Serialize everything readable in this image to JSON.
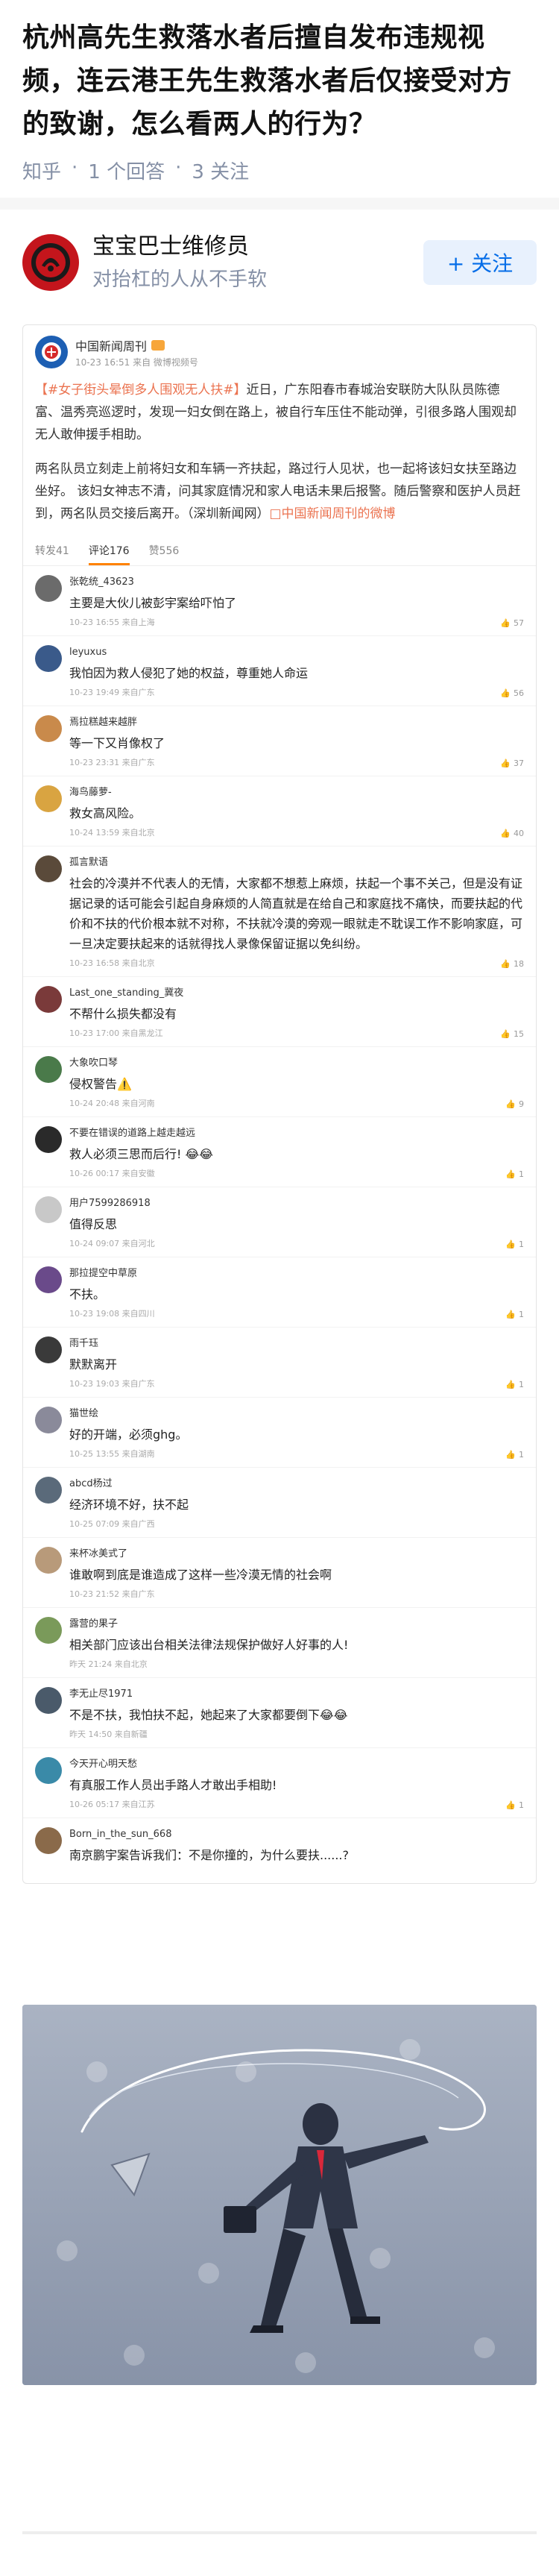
{
  "question": {
    "title": "杭州高先生救落水者后擅自发布违规视频，连云港王先生救落水者后仅接受对方的致谢，怎么看两人的行为？",
    "source": "知乎",
    "answers": "1 个回答",
    "followers": "3 关注"
  },
  "author": {
    "name": "宝宝巴士维修员",
    "bio": "对抬杠的人从不手软",
    "follow_label": "+ 关注"
  },
  "weibo": {
    "account": "中国新闻周刊",
    "time": "10-23 16:51 来自 微博视频号",
    "hashtag": "【#女子街头晕倒多人围观无人扶#】",
    "paragraph1": "近日，广东阳春市春城治安联防大队队员陈德富、温秀亮巡逻时，发现一妇女倒在路上，被自行车压住不能动弹，引很多路人围观却无人敢伸援手相助。",
    "paragraph2_main": "两名队员立刻走上前将妇女和车辆一齐扶起，路过行人见状，也一起将该妇女扶至路边坐好。 该妇女神志不清，问其家庭情况和家人电话未果后报警。随后警察和医护人员赶到，两名队员交接后离开。（深圳新闻网）",
    "paragraph2_link": "□中国新闻周刊的微博",
    "tabs": [
      "转发41",
      "评论176",
      "赞556"
    ],
    "comments": [
      {
        "user": "张乾统_43623",
        "text": "主要是大伙儿被彭宇案给吓怕了",
        "meta": "10-23 16:55 来自上海",
        "likes": "57",
        "color": "#6b6b6b"
      },
      {
        "user": "leyuxus",
        "text": "我怕因为救人侵犯了她的权益，尊重她人命运",
        "meta": "10-23 19:49 来自广东",
        "likes": "56",
        "color": "#3a5a8a"
      },
      {
        "user": "焉拉糕越来越胖",
        "text": "等一下又肖像权了",
        "meta": "10-23 23:31 来自广东",
        "likes": "37",
        "color": "#c98a4b"
      },
      {
        "user": "海鸟藤萝-",
        "text": "救女高风险。",
        "meta": "10-24 13:59 来自北京",
        "likes": "40",
        "color": "#d9a441"
      },
      {
        "user": "孤言默语",
        "text": "社会的冷漠并不代表人的无情，大家都不想惹上麻烦，扶起一个事不关己，但是没有证据记录的话可能会引起自身麻烦的人简直就是在给自己和家庭找不痛快，而要扶起的代价和不扶的代价根本就不对称，不扶就冷漠的旁观一眼就走不耽误工作不影响家庭，可一旦决定要扶起来的话就得找人录像保留证据以免纠纷。",
        "meta": "10-23 16:58 来自北京",
        "likes": "18",
        "color": "#5a4a3a"
      },
      {
        "user": "Last_one_standing_冀夜",
        "text": "不帮什么损失都没有",
        "meta": "10-23 17:00 来自黑龙江",
        "likes": "15",
        "color": "#7a3a3a"
      },
      {
        "user": "大象吹口琴",
        "text": "侵权警告⚠️",
        "meta": "10-24 20:48 来自河南",
        "likes": "9",
        "color": "#4a7a4a"
      },
      {
        "user": "不要在错误的道路上越走越远",
        "text": "救人必须三思而后行! 😂😂",
        "meta": "10-26 00:17 来自安徽",
        "likes": "1",
        "color": "#2a2a2a"
      },
      {
        "user": "用户7599286918",
        "text": "值得反思",
        "meta": "10-24 09:07 来自河北",
        "likes": "1",
        "color": "#c8c8c8"
      },
      {
        "user": "那拉提空中草原",
        "text": "不扶。",
        "meta": "10-23 19:08 来自四川",
        "likes": "1",
        "color": "#6a4a8a"
      },
      {
        "user": "雨千珏",
        "text": "默默离开",
        "meta": "10-23 19:03 来自广东",
        "likes": "1",
        "color": "#3a3a3a"
      },
      {
        "user": "猫世绘",
        "text": "好的开端，必须ghg。",
        "meta": "10-25 13:55 来自湖南",
        "likes": "1",
        "color": "#8a8a9a"
      },
      {
        "user": "abcd杨过",
        "text": "经济环境不好，扶不起",
        "meta": "10-25 07:09 来自广西",
        "likes": "",
        "color": "#5a6a7a"
      },
      {
        "user": "来杯冰美式了",
        "text": "谁敢啊到底是谁造成了这样一些冷漠无情的社会啊",
        "meta": "10-23 21:52 来自广东",
        "likes": "",
        "color": "#b89a7a"
      },
      {
        "user": "露营的果子",
        "text": "相关部门应该出台相关法律法规保护做好人好事的人!",
        "meta": "昨天 21:24 来自北京",
        "likes": "",
        "color": "#7a9a5a"
      },
      {
        "user": "李无止尽1971",
        "text": "不是不扶，我怕扶不起，她起来了大家都要倒下😂😂",
        "meta": "昨天 14:50 来自新疆",
        "likes": "",
        "color": "#4a5a6a"
      },
      {
        "user": "今天开心明天愁",
        "text": "有真服工作人员出手路人才敢出手相助!",
        "meta": "10-26 05:17 来自江苏",
        "likes": "1",
        "color": "#3a8aa8"
      },
      {
        "user": "Born_in_the_sun_668",
        "text": "南京鹏宇案告诉我们：不是你撞的，为什么要扶......?",
        "meta": "",
        "likes": "",
        "color": "#8a6a4a"
      }
    ]
  },
  "colors": {
    "zhihu_blue": "#056de8",
    "weibo_orange": "#eb7350",
    "meta_gray": "#8590a6"
  }
}
